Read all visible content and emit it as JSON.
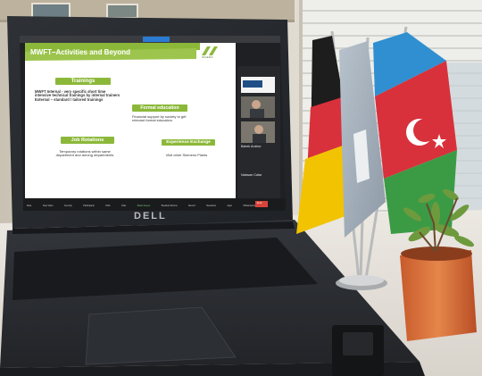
{
  "slide": {
    "title": "MWFT–Activities and Beyond",
    "logo_text": "SICENO",
    "sections": [
      {
        "heading": "Trainings",
        "body": "MWFT Internal - very specific short time intensive technical trainings by internal trainers\nExternal – standard / tailored trainings"
      },
      {
        "heading": "Formal education",
        "body": "Financial support by society to get relevant formal education"
      },
      {
        "heading": "Job Rotations",
        "body": "Temporary rotations within same department and among departments"
      },
      {
        "heading": "Experience Exchange",
        "body": "Visit other Siemens Plants"
      }
    ]
  },
  "meeting": {
    "participants": [
      "Babek Arabov",
      "Natavan Cafar"
    ],
    "toolbar": [
      "Mute",
      "Stop Video",
      "Security",
      "Participants",
      "Polls",
      "Chat",
      "Share Screen",
      "Breakout Rooms",
      "Record",
      "Reactions",
      "Apps",
      "Whiteboards",
      "End"
    ]
  },
  "laptop": {
    "brand": "DELL"
  },
  "colors": {
    "slide_green": "#8cb83a",
    "end_button": "#d9443a",
    "flag_blue": "#2f8fd0",
    "flag_red": "#d8313c",
    "flag_green": "#3b9b45"
  }
}
